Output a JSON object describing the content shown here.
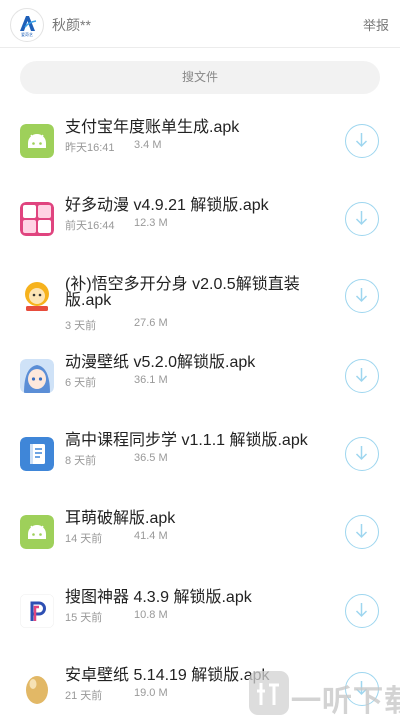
{
  "header": {
    "logo_text": "爱奇艺",
    "user_name": "秋颜**",
    "report_label": "举报"
  },
  "search": {
    "label": "搜文件"
  },
  "files": [
    {
      "name": "支付宝年度账单生成.apk",
      "time": "昨天16:41",
      "size": "3.4 M",
      "icon": "android-icon"
    },
    {
      "name": "好多动漫 v4.9.21 解锁版.apk",
      "time": "前天16:44",
      "size": "12.3 M",
      "icon": "haoduo-dongman-icon"
    },
    {
      "name": "(补)悟空多开分身 v2.0.5解锁直装版.apk",
      "time": "3 天前",
      "size": "27.6 M",
      "icon": "wukong-icon"
    },
    {
      "name": "动漫壁纸 v5.2.0解锁版.apk",
      "time": "6 天前",
      "size": "36.1 M",
      "icon": "anime-girl-icon"
    },
    {
      "name": "高中课程同步学 v1.1.1 解锁版.apk",
      "time": "8 天前",
      "size": "36.5 M",
      "icon": "document-icon"
    },
    {
      "name": "耳萌破解版.apk",
      "time": "14 天前",
      "size": "41.4 M",
      "icon": "android-icon"
    },
    {
      "name": "搜图神器 4.3.9 解锁版.apk",
      "time": "15 天前",
      "size": "10.8 M",
      "icon": "p-logo-icon"
    },
    {
      "name": "安卓壁纸 5.14.19 解锁版.apk",
      "time": "21 天前",
      "size": "19.0 M",
      "icon": "egg-icon"
    }
  ],
  "watermark": {
    "text": "一听下载"
  },
  "colors": {
    "android_green": "#9ed05a",
    "download_ring": "#9ed6ef",
    "doc_blue": "#3f86d8"
  }
}
